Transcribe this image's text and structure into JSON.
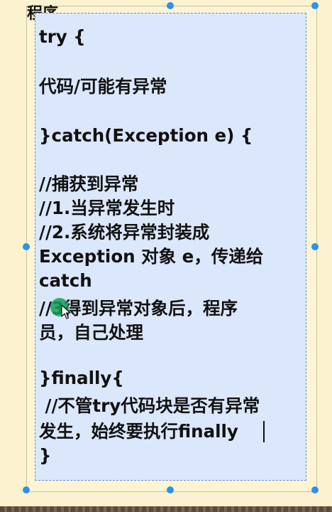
{
  "slide": {
    "clipped_title": "程序"
  },
  "code_box": {
    "lines": [
      "try {",
      "代码/可能有异常",
      "}catch(Exception e) {",
      "//捕获到异常",
      "//1.当异常发生时",
      "//2.系统将异常封装成",
      "Exception 对象 e，传递给",
      "catch",
      "//3得到异常对象后，程序",
      "员，自己处理",
      "}finally{",
      " //不管try代码块是否有异常",
      "发生，始终要执行finally",
      "}"
    ]
  },
  "colors": {
    "background": "#fbf2cf",
    "text_box": "#dbe7fb",
    "selection_handle": "#2e92e8",
    "cursor_highlight": "#14a05a"
  },
  "icons": [
    "selection-handle",
    "mouse-pointer-icon"
  ]
}
